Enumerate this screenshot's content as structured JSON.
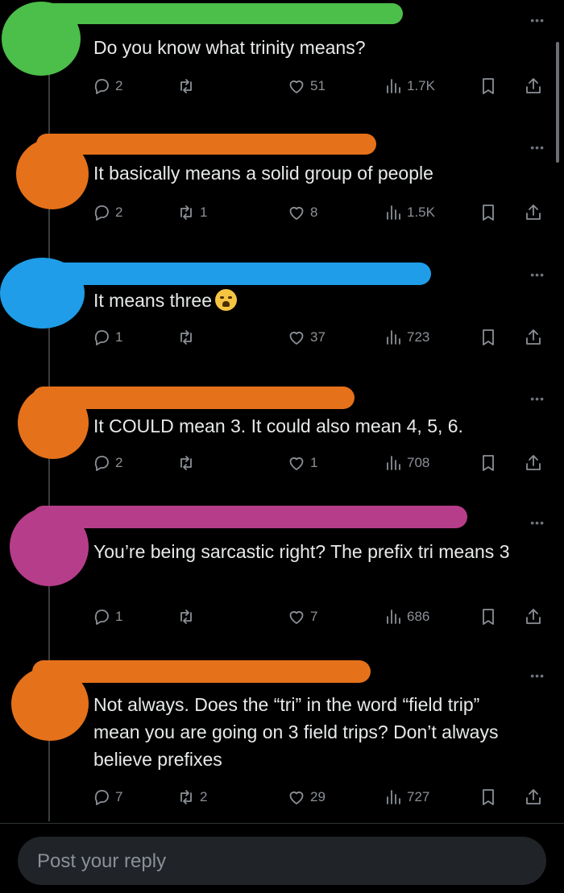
{
  "posts": [
    {
      "text": "Do you know what trinity means?",
      "replies": "2",
      "reposts": "",
      "likes": "51",
      "views": "1.7K",
      "redaction_color": "#4cbe4a"
    },
    {
      "text": "It basically means a solid group of people",
      "replies": "2",
      "reposts": "1",
      "likes": "8",
      "views": "1.5K",
      "redaction_color": "#e5711b"
    },
    {
      "text": "It means three",
      "emoji": "loudly-crying-face",
      "replies": "1",
      "reposts": "",
      "likes": "37",
      "views": "723",
      "redaction_color": "#1f9de8"
    },
    {
      "text": "It COULD mean 3. It could also mean 4, 5, 6.",
      "replies": "2",
      "reposts": "",
      "likes": "1",
      "views": "708",
      "redaction_color": "#e5711b"
    },
    {
      "text": "You’re being sarcastic right? The prefix tri means 3",
      "replies": "1",
      "reposts": "",
      "likes": "7",
      "views": "686",
      "redaction_color": "#b63d8a"
    },
    {
      "text": "Not always. Does the “tri” in the word “field trip” mean you are going on 3 field trips? Don’t always believe prefixes",
      "replies": "7",
      "reposts": "2",
      "likes": "29",
      "views": "727",
      "redaction_color": "#e5711b"
    }
  ],
  "reply_box": {
    "placeholder": "Post your reply"
  },
  "icons": {
    "reply": "reply-icon",
    "repost": "repost-icon",
    "like": "heart-icon",
    "views": "views-icon",
    "bookmark": "bookmark-icon",
    "share": "share-icon",
    "more": "more-icon"
  }
}
